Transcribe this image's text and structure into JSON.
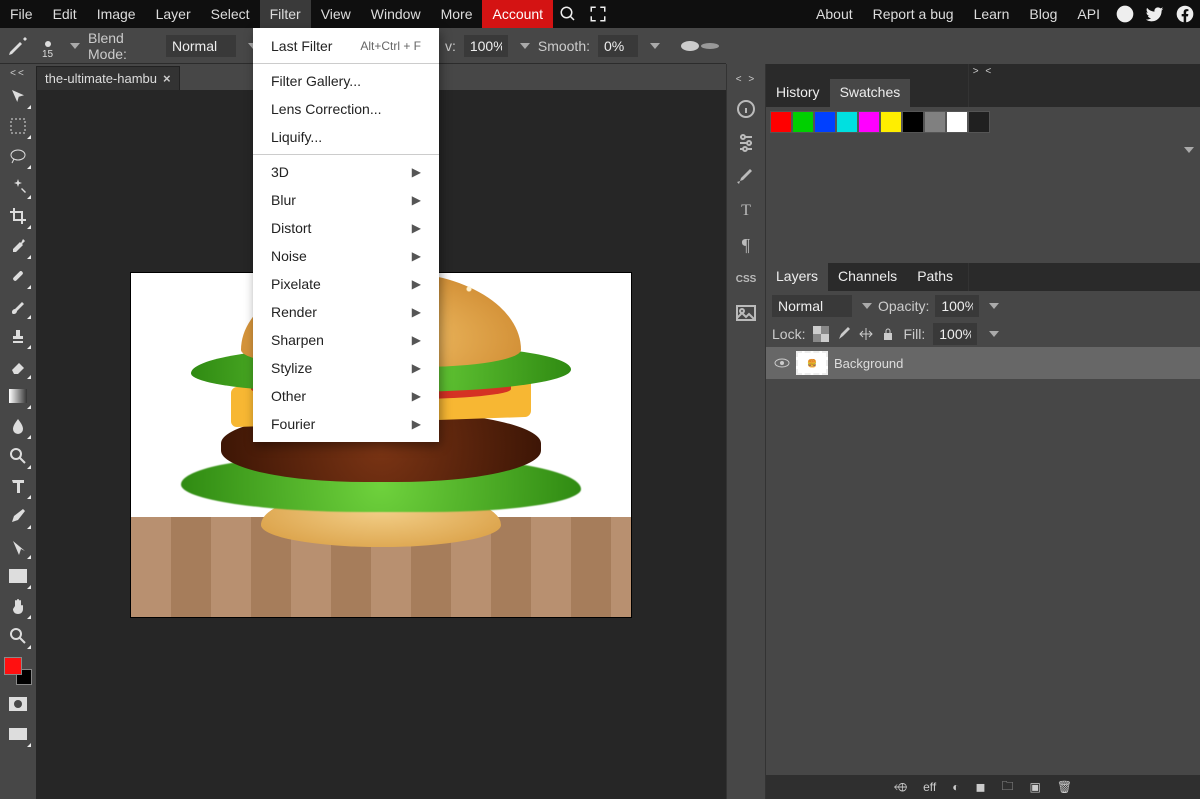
{
  "menubar": {
    "left": [
      "File",
      "Edit",
      "Image",
      "Layer",
      "Select",
      "Filter",
      "View",
      "Window",
      "More"
    ],
    "account": "Account",
    "right": [
      "About",
      "Report a bug",
      "Learn",
      "Blog",
      "API"
    ],
    "active_index": 5
  },
  "options": {
    "brush_size": "15",
    "blend_mode_label": "Blend Mode:",
    "blend_mode": "Normal",
    "opacity_trunc_label": "v:",
    "opacity": "100%",
    "smooth_label": "Smooth:",
    "smooth": "0%"
  },
  "document": {
    "tab_name": "the-ultimate-hambu"
  },
  "collapse": {
    "left": "<<",
    "center": "< >",
    "right": "> <"
  },
  "filter_menu": {
    "top": {
      "label": "Last Filter",
      "shortcut": "Alt+Ctrl + F"
    },
    "items": [
      "Filter Gallery...",
      "Lens Correction...",
      "Liquify..."
    ],
    "submenus": [
      "3D",
      "Blur",
      "Distort",
      "Noise",
      "Pixelate",
      "Render",
      "Sharpen",
      "Stylize",
      "Other",
      "Fourier"
    ]
  },
  "panels": {
    "history_tabs": [
      "History",
      "Swatches"
    ],
    "history_active": 1,
    "swatches": [
      "#ff0000",
      "#00d000",
      "#0040ff",
      "#00e0e0",
      "#ff00ff",
      "#ffee00",
      "#000000",
      "#808080",
      "#ffffff",
      "#202020"
    ],
    "layers_tabs": [
      "Layers",
      "Channels",
      "Paths"
    ],
    "layers_active": 0,
    "blend_mode": "Normal",
    "opacity_label": "Opacity:",
    "opacity": "100%",
    "lock_label": "Lock:",
    "fill_label": "Fill:",
    "fill": "100%",
    "layer_name": "Background",
    "footer_icons": [
      "⬲",
      "eff",
      "◐",
      "◼",
      "▣",
      "🗑"
    ]
  },
  "right_strip_css": "CSS",
  "colors": {
    "fg": "#ff1010",
    "bg": "#000000"
  },
  "tools": [
    "move",
    "marquee",
    "lasso",
    "wand",
    "crop",
    "eyedrop",
    "heal",
    "brush",
    "stamp",
    "eraser",
    "gradient",
    "blur",
    "dodge",
    "type",
    "pen",
    "path",
    "shape",
    "hand",
    "zoom"
  ]
}
